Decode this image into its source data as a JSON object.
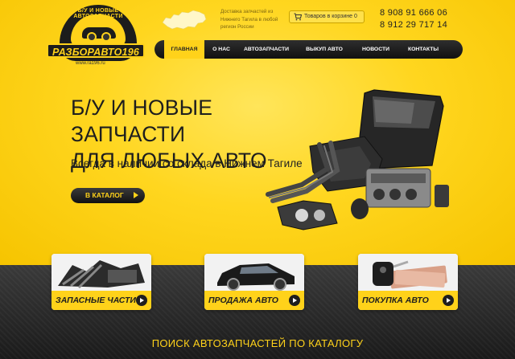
{
  "logo": {
    "arc_text": "Б/У И НОВЫЕ АВТОЗАПЧАСТИ",
    "name": "РАЗБОРАВТО196",
    "url": "www.ra196.ru"
  },
  "header": {
    "delivery_text": "Доставка запчастей из Нижнего Тагила в любой регион России",
    "cart_label": "Товаров в корзине 0",
    "phone1": "8 908 91 666 06",
    "phone2": "8 912 29 717 14"
  },
  "nav": {
    "items": [
      {
        "label": "ГЛАВНАЯ",
        "active": true
      },
      {
        "label": "О НАС"
      },
      {
        "label": "АВТОЗАПЧАСТИ"
      },
      {
        "label": "ВЫКУП АВТО"
      },
      {
        "label": "НОВОСТИ"
      },
      {
        "label": "КОНТАКТЫ"
      }
    ]
  },
  "hero": {
    "title_line1": "Б/У И НОВЫЕ ЗАПЧАСТИ",
    "title_line2": "ДЛЯ ЛЮБЫХ АВТО",
    "subtitle": "Всегда в наличии со склада в Нижнем Тагиле",
    "catalog_button": "В КАТАЛОГ"
  },
  "cards": [
    {
      "label": "ЗАПАСНЫЕ ЧАСТИ"
    },
    {
      "label": "ПРОДАЖА АВТО"
    },
    {
      "label": "ПОКУПКА АВТО"
    }
  ],
  "footer_heading": "ПОИСК АВТОЗАПЧАСТЕЙ ПО КАТАЛОГУ",
  "colors": {
    "accent": "#ffd21a",
    "dark": "#1c1c1c"
  }
}
